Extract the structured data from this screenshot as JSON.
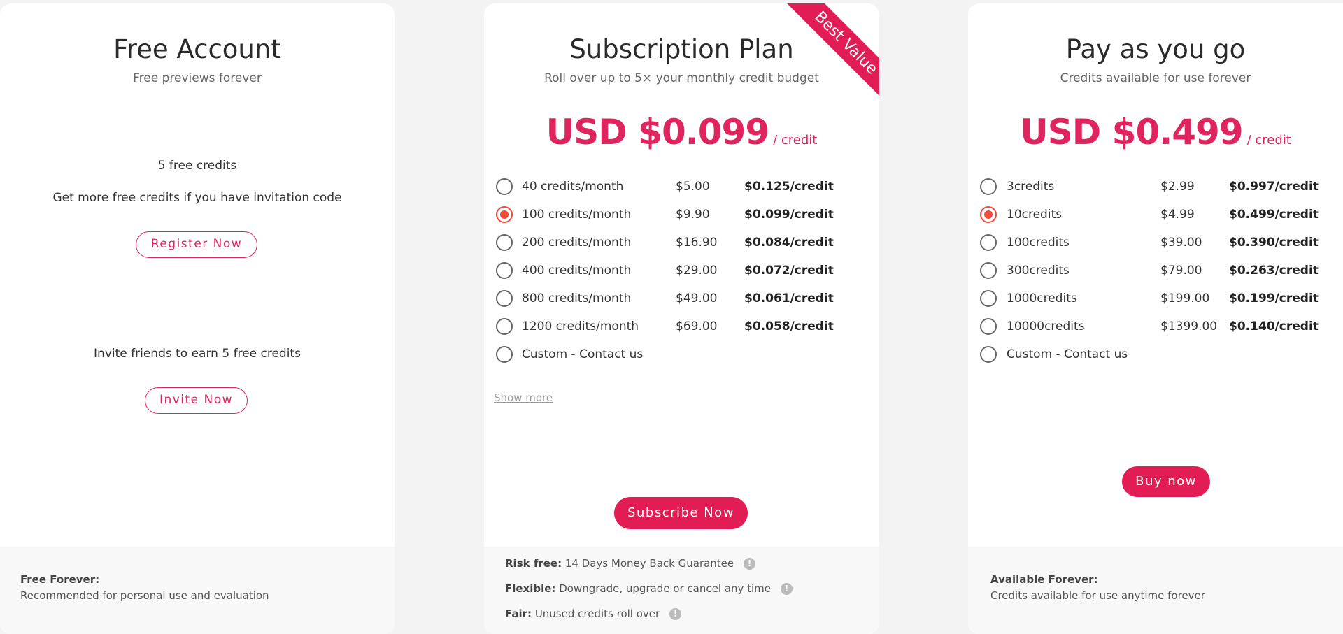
{
  "accent_color": "#e21d55",
  "selected_radio_color": "#f04a3a",
  "free": {
    "title": "Free Account",
    "subtitle": "Free previews forever",
    "credits_text": "5 free credits",
    "invite_code_text": "Get more free credits if you have invitation code",
    "register_label": "Register Now",
    "invite_text": "Invite friends to earn 5 free credits",
    "invite_label": "Invite Now",
    "footer_title": "Free Forever:",
    "footer_text": "Recommended for personal use and evaluation"
  },
  "subscription": {
    "ribbon": "Best Value",
    "title": "Subscription Plan",
    "subtitle": "Roll over up to 5× your monthly credit budget",
    "price": "USD $0.099",
    "price_unit": "/ credit",
    "options": [
      {
        "label": "40 credits/month",
        "price": "$5.00",
        "per": "$0.125/credit",
        "selected": false
      },
      {
        "label": "100 credits/month",
        "price": "$9.90",
        "per": "$0.099/credit",
        "selected": true
      },
      {
        "label": "200 credits/month",
        "price": "$16.90",
        "per": "$0.084/credit",
        "selected": false
      },
      {
        "label": "400 credits/month",
        "price": "$29.00",
        "per": "$0.072/credit",
        "selected": false
      },
      {
        "label": "800 credits/month",
        "price": "$49.00",
        "per": "$0.061/credit",
        "selected": false
      },
      {
        "label": "1200 credits/month",
        "price": "$69.00",
        "per": "$0.058/credit",
        "selected": false
      },
      {
        "label": "Custom - Contact us",
        "price": "",
        "per": "",
        "selected": false
      }
    ],
    "show_more": "Show more",
    "subscribe_label": "Subscribe Now",
    "features": [
      {
        "bold": "Risk free:",
        "text": "14 Days Money Back Guarantee",
        "icon": "info-icon"
      },
      {
        "bold": "Flexible:",
        "text": "Downgrade, upgrade or cancel any time",
        "icon": "info-icon"
      },
      {
        "bold": "Fair:",
        "text": "Unused credits roll over",
        "icon": "info-icon"
      }
    ]
  },
  "payg": {
    "title": "Pay as you go",
    "subtitle": "Credits available for use forever",
    "price": "USD $0.499",
    "price_unit": "/ credit",
    "options": [
      {
        "label": "3credits",
        "price": "$2.99",
        "per": "$0.997/credit",
        "selected": false
      },
      {
        "label": "10credits",
        "price": "$4.99",
        "per": "$0.499/credit",
        "selected": true
      },
      {
        "label": "100credits",
        "price": "$39.00",
        "per": "$0.390/credit",
        "selected": false
      },
      {
        "label": "300credits",
        "price": "$79.00",
        "per": "$0.263/credit",
        "selected": false
      },
      {
        "label": "1000credits",
        "price": "$199.00",
        "per": "$0.199/credit",
        "selected": false
      },
      {
        "label": "10000credits",
        "price": "$1399.00",
        "per": "$0.140/credit",
        "selected": false
      },
      {
        "label": "Custom - Contact us",
        "price": "",
        "per": "",
        "selected": false
      }
    ],
    "buy_label": "Buy now",
    "footer_title": "Available Forever:",
    "footer_text": "Credits available for use anytime forever"
  }
}
